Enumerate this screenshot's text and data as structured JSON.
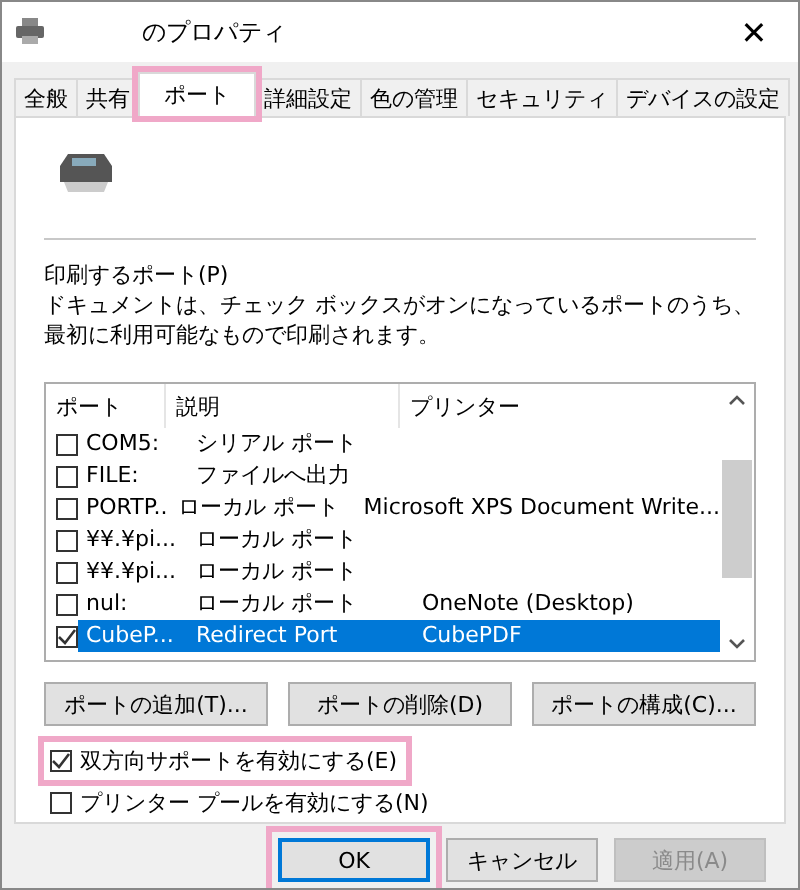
{
  "window": {
    "title": "のプロパティ",
    "close": "✕"
  },
  "tabs": [
    {
      "label": "全般",
      "selected": false,
      "highlighted": false
    },
    {
      "label": "共有",
      "selected": false,
      "highlighted": false
    },
    {
      "label": "ポート",
      "selected": true,
      "highlighted": true
    },
    {
      "label": "詳細設定",
      "selected": false,
      "highlighted": false
    },
    {
      "label": "色の管理",
      "selected": false,
      "highlighted": false
    },
    {
      "label": "セキュリティ",
      "selected": false,
      "highlighted": false
    },
    {
      "label": "デバイスの設定",
      "selected": false,
      "highlighted": false
    }
  ],
  "ports": {
    "label": "印刷するポート(P)",
    "description": "ドキュメントは、チェック ボックスがオンになっているポートのうち、最初に利用可能なもので印刷されます。",
    "columns": [
      "ポート",
      "説明",
      "プリンター"
    ],
    "rows": [
      {
        "port": "COM5:",
        "description": "シリアル ポート",
        "checked": false,
        "selected": false
      },
      {
        "port": "FILE:",
        "description": "ファイルへ出力",
        "checked": false,
        "selected": false
      },
      {
        "port": "PORTP..",
        "description": "ローカル ポート",
        "printer": "Microsoft XPS Document Write...",
        "checked": false,
        "selected": false
      },
      {
        "port": "¥¥.¥pi...",
        "description": "ローカル ポート",
        "checked": false,
        "selected": false
      },
      {
        "port": "¥¥.¥pi...",
        "description": "ローカル ポート",
        "checked": false,
        "selected": false
      },
      {
        "port": "nul:",
        "description": "ローカル ポート",
        "printer": "OneNote (Desktop)",
        "checked": false,
        "selected": false
      },
      {
        "port": "CubeP...",
        "description": "Redirect Port",
        "printer": "CubePDF",
        "checked": true,
        "selected": true
      }
    ]
  },
  "port_buttons": [
    "ポートの追加(T)...",
    "ポートの削除(D)",
    "ポートの構成(C)..."
  ],
  "options": [
    {
      "label": "双方向サポートを有効にする(E)",
      "checked": true,
      "highlighted": true
    },
    {
      "label": "プリンター プールを有効にする(N)",
      "checked": false,
      "highlighted": false
    }
  ],
  "footer_buttons": [
    {
      "label": "OK",
      "disabled": false,
      "default": true,
      "highlighted": true
    },
    {
      "label": "キャンセル",
      "disabled": false,
      "default": false,
      "highlighted": false
    },
    {
      "label": "適用(A)",
      "disabled": true,
      "default": false,
      "highlighted": false
    }
  ]
}
